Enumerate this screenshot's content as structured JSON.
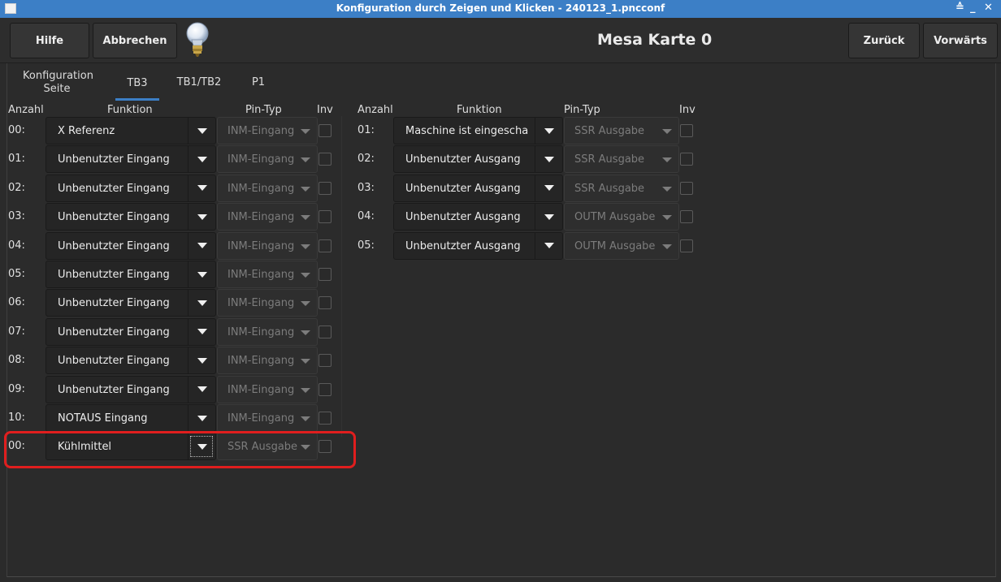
{
  "window": {
    "title": "Konfiguration durch Zeigen und Klicken - 240123_1.pncconf",
    "controls": [
      "≙",
      "_",
      "✕"
    ]
  },
  "header": {
    "help_label": "Hilfe",
    "cancel_label": "Abbrechen",
    "page_title": "Mesa Karte 0",
    "back_label": "Zurück",
    "forward_label": "Vorwärts"
  },
  "tabs": [
    {
      "line1": "Konfiguration",
      "line2": "Seite"
    },
    {
      "label": "TB3",
      "selected": true
    },
    {
      "label": "TB1/TB2"
    },
    {
      "label": "P1"
    }
  ],
  "columns": {
    "left": {
      "anzahl": "Anzahl",
      "funktion": "Funktion",
      "pintyp": "Pin-Typ",
      "inv": "Inv"
    },
    "right": {
      "anzahl": "Anzahl",
      "funktion": "Funktion",
      "pintyp": "Pin-Typ",
      "inv": "Inv"
    }
  },
  "inputs": [
    {
      "num": "00:",
      "funktion": "X Referenz",
      "pintyp": "INM-Eingang"
    },
    {
      "num": "01:",
      "funktion": "Unbenutzter Eingang",
      "pintyp": "INM-Eingang"
    },
    {
      "num": "02:",
      "funktion": "Unbenutzter Eingang",
      "pintyp": "INM-Eingang"
    },
    {
      "num": "03:",
      "funktion": "Unbenutzter Eingang",
      "pintyp": "INM-Eingang"
    },
    {
      "num": "04:",
      "funktion": "Unbenutzter Eingang",
      "pintyp": "INM-Eingang"
    },
    {
      "num": "05:",
      "funktion": "Unbenutzter Eingang",
      "pintyp": "INM-Eingang"
    },
    {
      "num": "06:",
      "funktion": "Unbenutzter Eingang",
      "pintyp": "INM-Eingang"
    },
    {
      "num": "07:",
      "funktion": "Unbenutzter Eingang",
      "pintyp": "INM-Eingang"
    },
    {
      "num": "08:",
      "funktion": "Unbenutzter Eingang",
      "pintyp": "INM-Eingang"
    },
    {
      "num": "09:",
      "funktion": "Unbenutzter Eingang",
      "pintyp": "INM-Eingang"
    },
    {
      "num": "10:",
      "funktion": "NOTAUS Eingang",
      "pintyp": "INM-Eingang"
    },
    {
      "num": "00:",
      "funktion": "Kühlmittel",
      "pintyp": "SSR Ausgabe"
    }
  ],
  "outputs": [
    {
      "num": "01:",
      "funktion": "Maschine ist eingescha",
      "pintyp": "SSR Ausgabe"
    },
    {
      "num": "02:",
      "funktion": "Unbenutzter Ausgang",
      "pintyp": "SSR Ausgabe"
    },
    {
      "num": "03:",
      "funktion": "Unbenutzter Ausgang",
      "pintyp": "SSR Ausgabe"
    },
    {
      "num": "04:",
      "funktion": "Unbenutzter Ausgang",
      "pintyp": "OUTM Ausgabe"
    },
    {
      "num": "05:",
      "funktion": "Unbenutzter Ausgang",
      "pintyp": "OUTM Ausgabe"
    }
  ],
  "colors": {
    "titlebar": "#3c7fc6",
    "highlight": "#e01e1e",
    "tab_underline": "#3c7fc6"
  }
}
